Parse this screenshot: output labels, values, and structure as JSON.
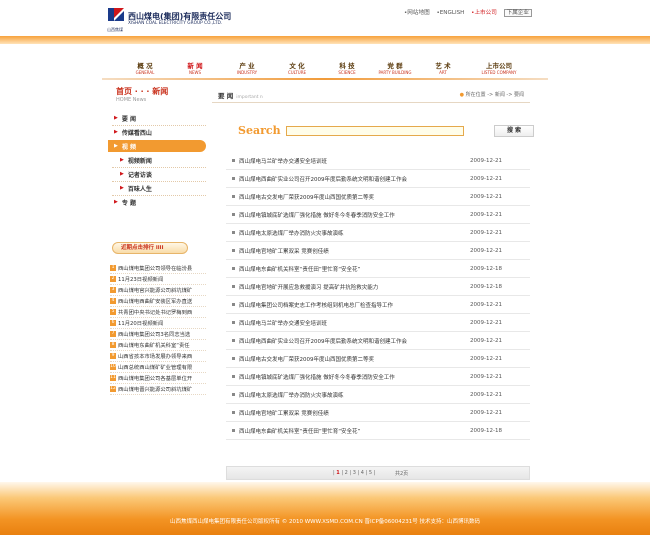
{
  "header": {
    "logo_cn": "西山煤电(集团)有限责任公司",
    "logo_en": "XISHAN COAL ELECTRICITY GROUP CO.,LTD.",
    "logo_sub": "山西焦煤",
    "links": {
      "sitemap": "•网站地图",
      "english": "•ENGLISH",
      "mall": "•上市公司",
      "cart": "下属企业"
    }
  },
  "nav": [
    {
      "cn": "概 况",
      "en": "GENERAL"
    },
    {
      "cn": "新 闻",
      "en": "NEWS"
    },
    {
      "cn": "产 业",
      "en": "INDUSTRY"
    },
    {
      "cn": "文 化",
      "en": "CULTURE"
    },
    {
      "cn": "科 技",
      "en": "SCIENCE"
    },
    {
      "cn": "党 群",
      "en": "PARTY BUILDING"
    },
    {
      "cn": "艺 术",
      "en": "ART"
    },
    {
      "cn": "上市公司",
      "en": "LISTED COMPANY"
    }
  ],
  "sidebar": {
    "title_cn": "首页 · · · 新闻",
    "title_en": "HOME      News",
    "items": [
      {
        "label": "要 闻"
      },
      {
        "label": "传媒看西山"
      },
      {
        "label": "视 频"
      },
      {
        "label": "视频新闻"
      },
      {
        "label": "记者访谈"
      },
      {
        "label": "百味人生"
      },
      {
        "label": "专 题"
      }
    ],
    "rank_title": "近期点击排行 iiii",
    "rank": [
      "西山煤电集团公司领导在临汾县",
      "11月23日视频新闻",
      "西山煤电官兴能源公司斜坑煤矿",
      "西山煤电西曲矿安装区军办直送",
      "共青团中央书记处书记罗梅到西",
      "11月20日视频新闻",
      "西山煤电集团公司3名同志当选",
      "西山煤电东曲矿机关科室“责任",
      "山西省孩本市场发展办领导来西",
      "山西总统西山煤矿矿业管理有限",
      "西山煤电集团公司各基层单位开",
      "西山煤电晋兴能源公司斜坑煤矿"
    ]
  },
  "main": {
    "title": "要 闻",
    "title_en": "important n",
    "crumb": "所在位置  ->  新闻  ->  要闻",
    "search_label": "Search",
    "search_placeholder": "",
    "search_button": "搜 索",
    "rows": [
      {
        "title": "西山煤电马兰矿举办交通安全培训班",
        "date": "2009-12-21"
      },
      {
        "title": "西山煤电西曲矿实业公司召开2009年度后勤系统文明和谐创建工作会",
        "date": "2009-12-21"
      },
      {
        "title": "西山煤电古交发电厂荣获2009年度山西国优质第二等奖",
        "date": "2009-12-21"
      },
      {
        "title": "西山煤电镇城底矿选煤厂强化措施  做好冬今冬春季消防安全工作",
        "date": "2009-12-21"
      },
      {
        "title": "西山煤电太原选煤厂举办消防火灾事故演练",
        "date": "2009-12-21"
      },
      {
        "title": "西山煤电官地矿工累双采  竞赛创佳绩",
        "date": "2009-12-21"
      },
      {
        "title": "西山煤电东曲矿机关科室“责任田”里忙育“安全花”",
        "date": "2009-12-18"
      },
      {
        "title": "西山煤电官地矿开展应急救援演习  提高矿井抗险救灾能力",
        "date": "2009-12-18"
      },
      {
        "title": "西山煤电集团公司档案史志工作考核组到机电总厂检查指导工作",
        "date": "2009-12-21"
      },
      {
        "title": "西山煤电马兰矿举办交通安全培训班",
        "date": "2009-12-21"
      },
      {
        "title": "西山煤电西曲矿实业公司召开2009年度后勤系统文明和谐创建工作会",
        "date": "2009-12-21"
      },
      {
        "title": "西山煤电古交发电厂荣获2009年度山西国优质第二等奖",
        "date": "2009-12-21"
      },
      {
        "title": "西山煤电镇城底矿选煤厂强化措施  做好冬今冬春季消防安全工作",
        "date": "2009-12-21"
      },
      {
        "title": "西山煤电太原选煤厂举办消防火灾事故演练",
        "date": "2009-12-21"
      },
      {
        "title": "西山煤电官地矿工累双采  竞赛创佳绩",
        "date": "2009-12-21"
      },
      {
        "title": "西山煤电东曲矿机关科室“责任田”里忙育“安全花”",
        "date": "2009-12-18"
      }
    ],
    "pager": {
      "current": "1",
      "others": [
        "2",
        "3",
        "4",
        "5"
      ],
      "total": "共2页"
    }
  },
  "footer": {
    "text": "山西焦煤西山煤电集团有限责任公司版权所有 ©  2010 WWW.XSMD.COM.CN  晋ICP备06004231号  技术支持：山西博讯数码"
  },
  "colors": {
    "accent": "#f29a30",
    "brand_red": "#d0161a"
  }
}
